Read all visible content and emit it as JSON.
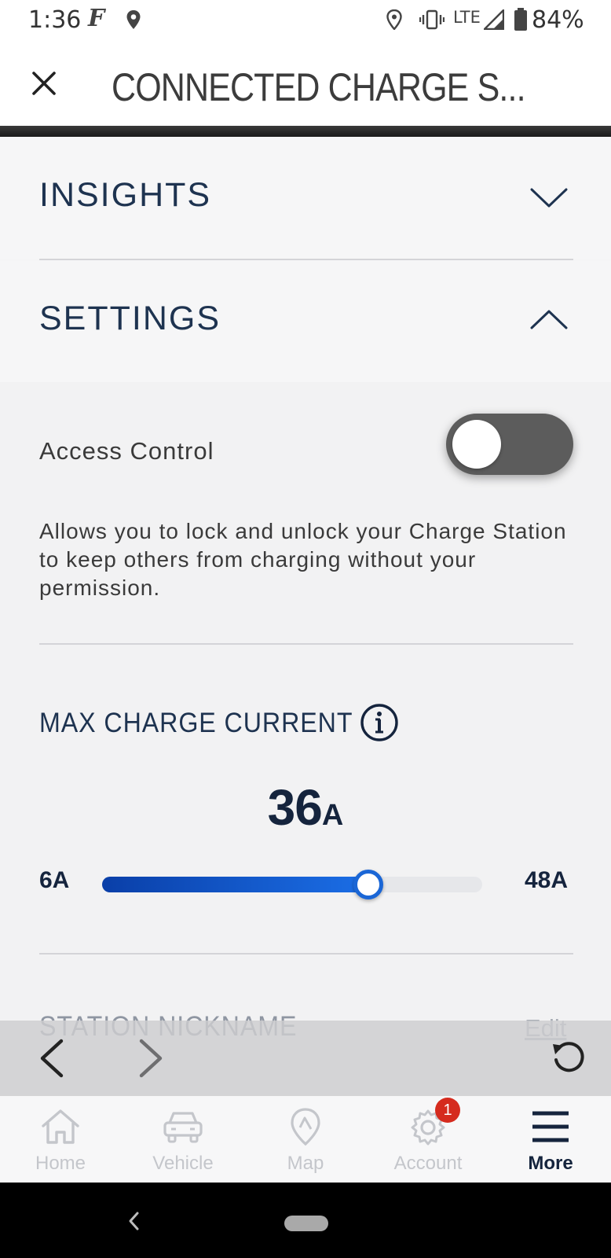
{
  "status_bar": {
    "time": "1:36",
    "app_glyph": "F",
    "network": "LTE",
    "battery_percent": "84%",
    "icons": [
      "location-icon",
      "vibrate-icon",
      "signal-icon",
      "battery-icon"
    ]
  },
  "header": {
    "title": "CONNECTED CHARGE S..."
  },
  "accordion": {
    "insights": {
      "label": "INSIGHTS",
      "expanded": false
    },
    "settings": {
      "label": "SETTINGS",
      "expanded": true
    }
  },
  "settings": {
    "access_control": {
      "label": "Access Control",
      "enabled": false,
      "description": "Allows you to lock and unlock your Charge Station to keep others from charging without your permission."
    },
    "max_charge_current": {
      "title": "MAX CHARGE CURRENT",
      "value": "36",
      "unit": "A",
      "min_label": "6A",
      "max_label": "48A",
      "fill_fraction": 0.7,
      "fill_color": "#1a66d6"
    },
    "station_nickname": {
      "label": "STATION NICKNAME",
      "edit_label": "Edit"
    }
  },
  "browser_nav": {
    "icons": [
      "back-arrow-icon",
      "forward-arrow-icon",
      "refresh-icon"
    ]
  },
  "tab_bar": {
    "tabs": [
      {
        "label": "Home",
        "icon": "home-icon",
        "active": false
      },
      {
        "label": "Vehicle",
        "icon": "car-icon",
        "active": false
      },
      {
        "label": "Map",
        "icon": "map-pin-icon",
        "active": false
      },
      {
        "label": "Account",
        "icon": "gear-icon",
        "active": false,
        "badge": "1"
      },
      {
        "label": "More",
        "icon": "menu-icon",
        "active": true
      }
    ]
  },
  "colors": {
    "brand_navy": "#15243d",
    "accent_blue": "#1a66d6",
    "badge_red": "#d52b1e"
  }
}
